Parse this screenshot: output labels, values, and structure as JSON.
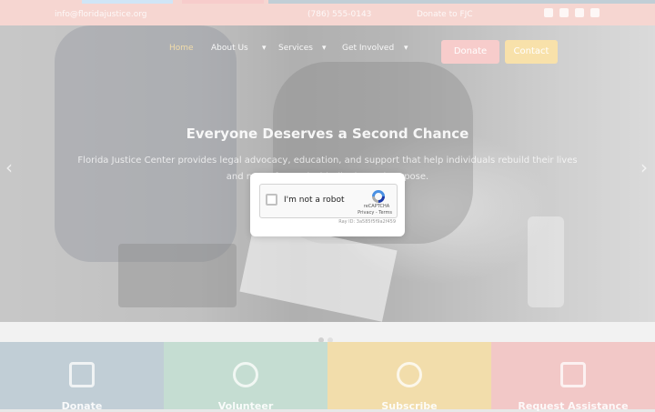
{
  "topbar": {
    "items": [
      "info@floridajustice.org",
      "(786) 555-0143",
      "Donate to FJC"
    ],
    "social_icons": [
      "instagram-icon",
      "twitter-icon",
      "youtube-icon",
      "linkedin-icon"
    ]
  },
  "nav": {
    "items": [
      "Home",
      "About Us",
      "Services",
      "Get Involved"
    ],
    "donate_label": "Donate",
    "contact_label": "Contact"
  },
  "hero": {
    "title": "Everyone Deserves a Second Chance",
    "subtitle": "Florida Justice Center provides legal advocacy, education, and support that help individuals rebuild their lives and move forward with dignity and purpose."
  },
  "cards": [
    {
      "label": "Donate",
      "icon": "donate-icon",
      "color": "#8fa6b4"
    },
    {
      "label": "Volunteer",
      "icon": "volunteer-icon",
      "color": "#96c2ad"
    },
    {
      "label": "Subscribe",
      "icon": "subscribe-icon",
      "color": "#e7c267"
    },
    {
      "label": "Request Assistance",
      "icon": "chat-icon",
      "color": "#e89c9a"
    }
  ],
  "captcha": {
    "label": "I'm not a robot",
    "brand": "reCAPTCHA",
    "privacy": "Privacy",
    "terms": "Terms",
    "ray_id": "Ray ID: 3a585f5f9a2f459"
  },
  "colors": {
    "topbar": "#eeb4ab",
    "donate_button": "#f0a3a1",
    "contact_button": "#f3c964"
  }
}
